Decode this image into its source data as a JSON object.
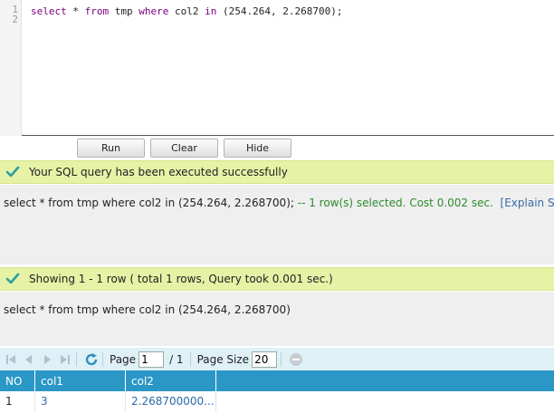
{
  "editor": {
    "line_numbers": [
      "1",
      "2"
    ],
    "code": {
      "kw_select": "select",
      "star": " * ",
      "kw_from": "from",
      "table": " tmp ",
      "kw_where": "where",
      "column": " col2 ",
      "kw_in": "in",
      "values": " (254.264, 2.268700);"
    }
  },
  "buttons": {
    "run": "Run",
    "clear": "Clear",
    "hide": "Hide"
  },
  "status_exec": {
    "message": "Your SQL query has been executed successfully"
  },
  "exec_panel": {
    "query": "select * from tmp where col2 in (254.264, 2.268700);",
    "result": " -- 1 row(s) selected. Cost 0.002 sec.",
    "explain_link": "[Explain SQL]"
  },
  "status_show": {
    "message": "Showing 1 - 1 row ( total 1 rows, Query took 0.001 sec.)"
  },
  "show_panel": {
    "query": "select * from tmp where col2 in (254.264, 2.268700)"
  },
  "pager": {
    "page_label": "Page",
    "page_value": "1",
    "of_total": "/ 1",
    "size_label": "Page Size",
    "size_value": "20"
  },
  "grid": {
    "columns": [
      "NO",
      "col1",
      "col2"
    ],
    "rows": [
      [
        "1",
        "3",
        "2.268700000..."
      ]
    ]
  },
  "colors": {
    "status_bg": "#e6f2a6",
    "grid_header": "#2b97c6",
    "check_green": "#2aa0a0",
    "ok_text": "#2e8a2e",
    "link": "#3a6aa8"
  }
}
